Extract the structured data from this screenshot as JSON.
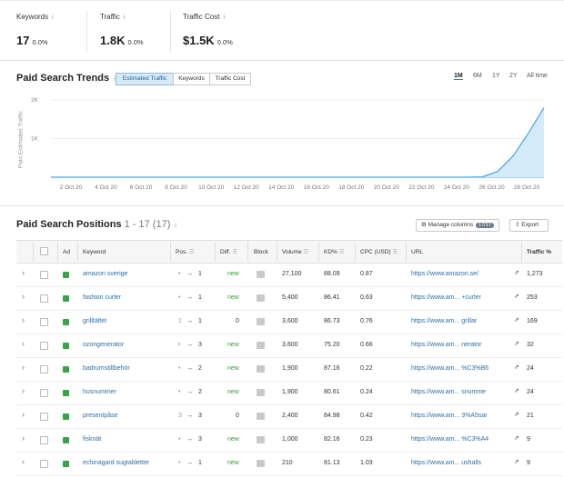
{
  "kpis": [
    {
      "label": "Keywords",
      "value": "17",
      "pct": "0.0%"
    },
    {
      "label": "Traffic",
      "value": "1.8K",
      "pct": "0.0%"
    },
    {
      "label": "Traffic Cost",
      "value": "$1.5K",
      "pct": "0.0%"
    }
  ],
  "info_glyph": "i",
  "trends": {
    "title": "Paid Search Trends",
    "segments": [
      "Estimated Traffic",
      "Keywords",
      "Traffic Cost"
    ],
    "active_segment": 0,
    "ranges": [
      "1M",
      "6M",
      "1Y",
      "2Y",
      "All time"
    ],
    "active_range": 0
  },
  "chart_data": {
    "type": "area",
    "ylabel": "Paid Estimated Traffic",
    "y_ticks": [
      "2K",
      "1K"
    ],
    "ylim": [
      0,
      2000
    ],
    "x_ticks": [
      "2 Oct 20",
      "4 Oct 20",
      "6 Oct 20",
      "8 Oct 20",
      "10 Oct 20",
      "12 Oct 20",
      "14 Oct 20",
      "16 Oct 20",
      "18 Oct 20",
      "20 Oct 20",
      "22 Oct 20",
      "24 Oct 20",
      "26 Oct 20",
      "28 Oct 20"
    ],
    "series": [
      {
        "values": [
          0,
          0,
          0,
          0,
          0,
          0,
          0,
          0,
          0,
          0,
          0,
          0,
          0,
          0,
          0,
          0,
          0,
          0,
          0,
          0,
          0,
          0,
          0,
          0,
          0,
          0,
          0,
          0,
          10,
          150,
          550,
          1150,
          1800
        ]
      }
    ],
    "colors": {
      "line": "#49a3e0",
      "fill": "#d6ebfa"
    }
  },
  "positions": {
    "title": "Paid Search Positions",
    "range": "1 - 17 (17)",
    "manage_columns": "Manage columns",
    "manage_badge": "17/17",
    "export": "Export"
  },
  "columns": [
    "Ad",
    "Keyword",
    "Pos.",
    "Diff.",
    "Block",
    "Volume",
    "KD%",
    "CPC (USD)",
    "URL",
    "Traffic %"
  ],
  "rows": [
    {
      "keyword": "amazon sverige",
      "pos_from": "•",
      "pos_to": "1",
      "diff": "new",
      "volume": "27,100",
      "kd": "88.09",
      "cpc": "0.87",
      "url": "https://www.amazon.se/",
      "traffic": "1,273"
    },
    {
      "keyword": "fashion curler",
      "pos_from": "•",
      "pos_to": "1",
      "diff": "new",
      "volume": "5,400",
      "kd": "86.41",
      "cpc": "0.63",
      "url": "https://www.am... +curler",
      "traffic": "253"
    },
    {
      "keyword": "grilltältet",
      "pos_from": "1",
      "pos_to": "1",
      "diff": "0",
      "volume": "3,600",
      "kd": "86.73",
      "cpc": "0.76",
      "url": "https://www.am... grillar",
      "traffic": "169"
    },
    {
      "keyword": "ozongenerator",
      "pos_from": "•",
      "pos_to": "3",
      "diff": "new",
      "volume": "3,600",
      "kd": "75.20",
      "cpc": "0.66",
      "url": "https://www.am... nerator",
      "traffic": "32"
    },
    {
      "keyword": "badrumstillbehör",
      "pos_from": "•",
      "pos_to": "2",
      "diff": "new",
      "volume": "1,900",
      "kd": "87.16",
      "cpc": "0.22",
      "url": "https://www.am... %C3%B6",
      "traffic": "24"
    },
    {
      "keyword": "husnummer",
      "pos_from": "•",
      "pos_to": "2",
      "diff": "new",
      "volume": "1,900",
      "kd": "80.61",
      "cpc": "0.24",
      "url": "https://www.am... snumme",
      "traffic": "24"
    },
    {
      "keyword": "presentpåse",
      "pos_from": "3",
      "pos_to": "3",
      "diff": "0",
      "volume": "2,400",
      "kd": "84.98",
      "cpc": "0.42",
      "url": "https://www.am... 3%A5sar",
      "traffic": "21"
    },
    {
      "keyword": "fisknät",
      "pos_from": "•",
      "pos_to": "3",
      "diff": "new",
      "volume": "1,000",
      "kd": "82.16",
      "cpc": "0.23",
      "url": "https://www.am... %C3%A4",
      "traffic": "9"
    },
    {
      "keyword": "echinagard sugtabletter",
      "pos_from": "•",
      "pos_to": "1",
      "diff": "new",
      "volume": "210",
      "kd": "81.13",
      "cpc": "1.03",
      "url": "https://www.am... ushalls",
      "traffic": "9"
    }
  ]
}
